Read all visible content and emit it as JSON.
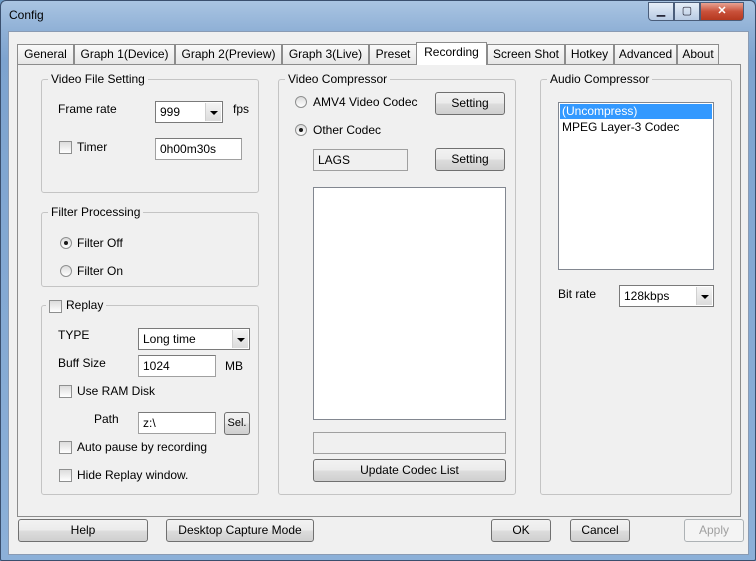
{
  "window": {
    "title": "Config"
  },
  "tabs": [
    "General",
    "Graph 1(Device)",
    "Graph 2(Preview)",
    "Graph 3(Live)",
    "Preset",
    "Recording",
    "Screen Shot",
    "Hotkey",
    "Advanced",
    "About"
  ],
  "active_tab": "Recording",
  "video_file": {
    "legend": "Video File Setting",
    "frame_rate_label": "Frame rate",
    "frame_rate_value": "999",
    "fps_label": "fps",
    "timer_label": "Timer",
    "timer_checked": false,
    "timer_value": "0h00m30s"
  },
  "filter": {
    "legend": "Filter Processing",
    "off_label": "Filter Off",
    "on_label": "Filter On",
    "selected": "off"
  },
  "replay": {
    "legend": "Replay",
    "checked": false,
    "type_label": "TYPE",
    "type_value": "Long time",
    "buff_label": "Buff Size",
    "buff_value": "1024",
    "buff_unit": "MB",
    "ram_disk_label": "Use RAM Disk",
    "path_label": "Path",
    "path_value": "z:\\",
    "sel_label": "Sel.",
    "auto_pause_label": "Auto pause by recording",
    "hide_window_label": "Hide Replay window."
  },
  "video_compressor": {
    "legend": "Video Compressor",
    "amv4_label": "AMV4 Video Codec",
    "other_label": "Other Codec",
    "selected": "other",
    "setting_label": "Setting",
    "codec_name": "LAGS",
    "update_label": "Update Codec List"
  },
  "audio_compressor": {
    "legend": "Audio Compressor",
    "codecs": [
      "(Uncompress)",
      "MPEG Layer-3 Codec"
    ],
    "selected_index": 0,
    "bitrate_label": "Bit rate",
    "bitrate_value": "128kbps"
  },
  "footer": {
    "help": "Help",
    "desktop_capture": "Desktop Capture Mode",
    "ok": "OK",
    "cancel": "Cancel",
    "apply": "Apply"
  }
}
